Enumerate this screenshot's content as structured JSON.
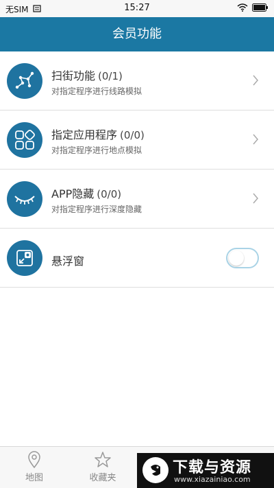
{
  "status_bar": {
    "carrier": "无SIM",
    "time": "15:27"
  },
  "header": {
    "title": "会员功能"
  },
  "rows": [
    {
      "title": "扫街功能",
      "count": "(0/1)",
      "subtitle": "对指定程序进行线路模拟",
      "icon": "route-icon"
    },
    {
      "title": "指定应用程序",
      "count": "(0/0)",
      "subtitle": "对指定程序进行地点模拟",
      "icon": "apps-grid-icon"
    },
    {
      "title": "APP隐藏",
      "count": "(0/0)",
      "subtitle": "对指定程序进行深度隐藏",
      "icon": "closed-eye-icon"
    },
    {
      "title": "悬浮窗",
      "icon": "floating-window-icon",
      "toggle_on": false
    }
  ],
  "bottom_nav": {
    "items": [
      {
        "label": "地图",
        "icon": "map-pin-icon"
      },
      {
        "label": "收藏夹",
        "icon": "star-icon"
      }
    ]
  },
  "watermark": {
    "title": "下载与资源",
    "url": "www.xiazainiao.com"
  },
  "colors": {
    "header": "#1b78a3",
    "icon_bg": "#1f73a0",
    "toggle_border": "#a9d3e6"
  }
}
